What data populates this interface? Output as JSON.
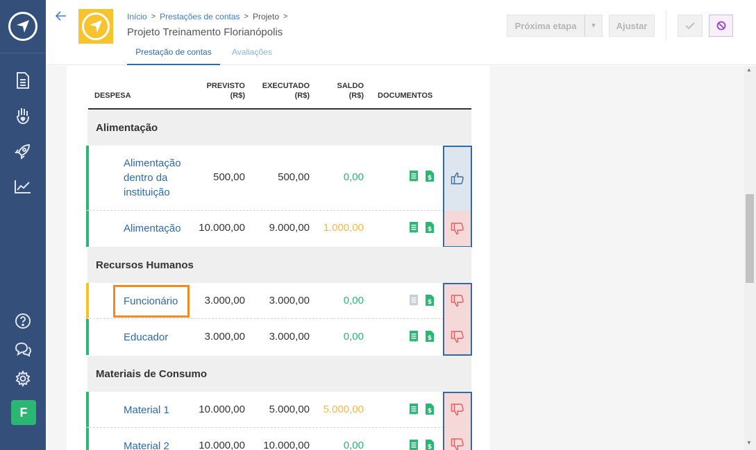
{
  "colors": {
    "sidebar": "#34507a",
    "accent_green": "#2bb673",
    "accent_yellow": "#f5c518",
    "link_blue": "#2e6aa8",
    "saldo_positive": "#2bb673",
    "saldo_warning": "#f5b942",
    "approve_bg": "#dde6ef",
    "reject_bg": "#f5d8d8",
    "highlight": "#f08a24"
  },
  "sidebar": {
    "avatar_letter": "F",
    "icons": [
      "document-icon",
      "hand-heart-icon",
      "rocket-icon",
      "chart-icon",
      "help-icon",
      "chat-icon",
      "settings-icon"
    ]
  },
  "header": {
    "breadcrumb": [
      "Início",
      "Prestações de contas",
      "Projeto"
    ],
    "title": "Projeto Treinamento Florianópolis",
    "tabs": [
      {
        "label": "Prestação de contas",
        "active": true
      },
      {
        "label": "Avaliações",
        "active": false
      }
    ],
    "buttons": {
      "next_step": "Próxima etapa",
      "adjust": "Ajustar"
    }
  },
  "table": {
    "columns": {
      "despesa": "DESPESA",
      "previsto_1": "PREVISTO",
      "previsto_2": "(R$)",
      "executado_1": "EXECUTADO",
      "executado_2": "(R$)",
      "saldo_1": "SALDO",
      "saldo_2": "(R$)",
      "documentos": "DOCUMENTOS"
    },
    "groups": [
      {
        "name": "Alimentação",
        "rows": [
          {
            "name": "Alimentação dentro da instituição",
            "previsto": "500,00",
            "executado": "500,00",
            "saldo": "0,00",
            "saldo_status": "ok",
            "rating": "approved",
            "accent": "green",
            "doc_state": "active"
          },
          {
            "name": "Alimentação",
            "previsto": "10.000,00",
            "executado": "9.000,00",
            "saldo": "1.000,00",
            "saldo_status": "warning",
            "rating": "rejected",
            "accent": "green",
            "doc_state": "active"
          }
        ]
      },
      {
        "name": "Recursos Humanos",
        "rows": [
          {
            "name": "Funcionário",
            "previsto": "3.000,00",
            "executado": "3.000,00",
            "saldo": "0,00",
            "saldo_status": "ok",
            "rating": "rejected",
            "accent": "yellow",
            "doc_state": "partial"
          },
          {
            "name": "Educador",
            "previsto": "3.000,00",
            "executado": "3.000,00",
            "saldo": "0,00",
            "saldo_status": "ok",
            "rating": "rejected",
            "accent": "green",
            "doc_state": "active"
          }
        ]
      },
      {
        "name": "Materiais de Consumo",
        "rows": [
          {
            "name": "Material 1",
            "previsto": "10.000,00",
            "executado": "5.000,00",
            "saldo": "5.000,00",
            "saldo_status": "warning",
            "rating": "rejected",
            "accent": "green",
            "doc_state": "active"
          },
          {
            "name": "Material 2",
            "previsto": "10.000,00",
            "executado": "10.000,00",
            "saldo": "0,00",
            "saldo_status": "ok",
            "rating": "rejected",
            "accent": "green",
            "doc_state": "active"
          }
        ]
      }
    ]
  }
}
